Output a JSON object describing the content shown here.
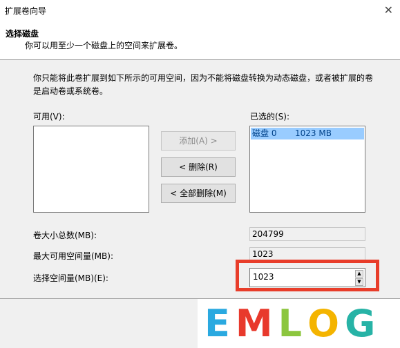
{
  "window": {
    "title": "扩展卷向导",
    "close_glyph": "✕"
  },
  "header": {
    "title": "选择磁盘",
    "subtitle": "你可以用至少一个磁盘上的空间来扩展卷。"
  },
  "description": "你只能将此卷扩展到如下所示的可用空间，因为不能将磁盘转换为动态磁盘，或者被扩展的卷是启动卷或系统卷。",
  "available": {
    "label": "可用(V):",
    "items": []
  },
  "selected": {
    "label": "已选的(S):",
    "items": [
      {
        "disk": "磁盘 0",
        "size": "1023 MB"
      }
    ]
  },
  "buttons": {
    "add": "添加(A) >",
    "remove": "< 删除(R)",
    "remove_all": "< 全部删除(M)"
  },
  "fields": {
    "total_label": "卷大小总数(MB):",
    "total_value": "204799",
    "max_label": "最大可用空间量(MB):",
    "max_value": "1023",
    "select_label": "选择空间量(MB)(E):",
    "select_value": "1023"
  },
  "watermark": {
    "letters": [
      "E",
      "M",
      "L",
      "O",
      "G"
    ],
    "colors": [
      "#2aa9e0",
      "#e8392c",
      "#8cc63e",
      "#f4b400",
      "#27b3a6"
    ]
  },
  "colors": {
    "highlight": "#e83d2a",
    "selection": "#99ccff"
  }
}
